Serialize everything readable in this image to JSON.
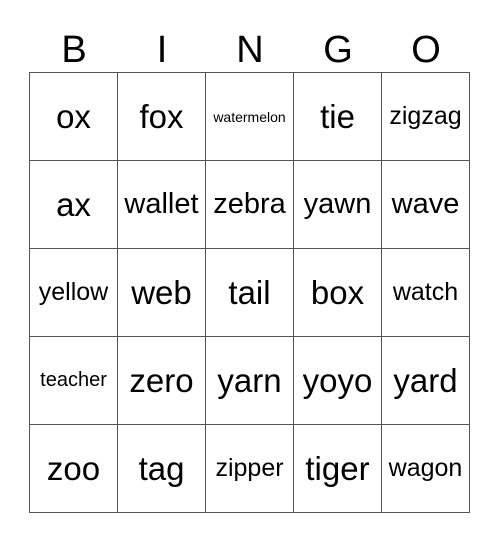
{
  "header": [
    "B",
    "I",
    "N",
    "G",
    "O"
  ],
  "rows": [
    [
      "ox",
      "fox",
      "watermelon",
      "tie",
      "zigzag"
    ],
    [
      "ax",
      "wallet",
      "zebra",
      "yawn",
      "wave"
    ],
    [
      "yellow",
      "web",
      "tail",
      "box",
      "watch"
    ],
    [
      "teacher",
      "zero",
      "yarn",
      "yoyo",
      "yard"
    ],
    [
      "zoo",
      "tag",
      "zipper",
      "tiger",
      "wagon"
    ]
  ]
}
